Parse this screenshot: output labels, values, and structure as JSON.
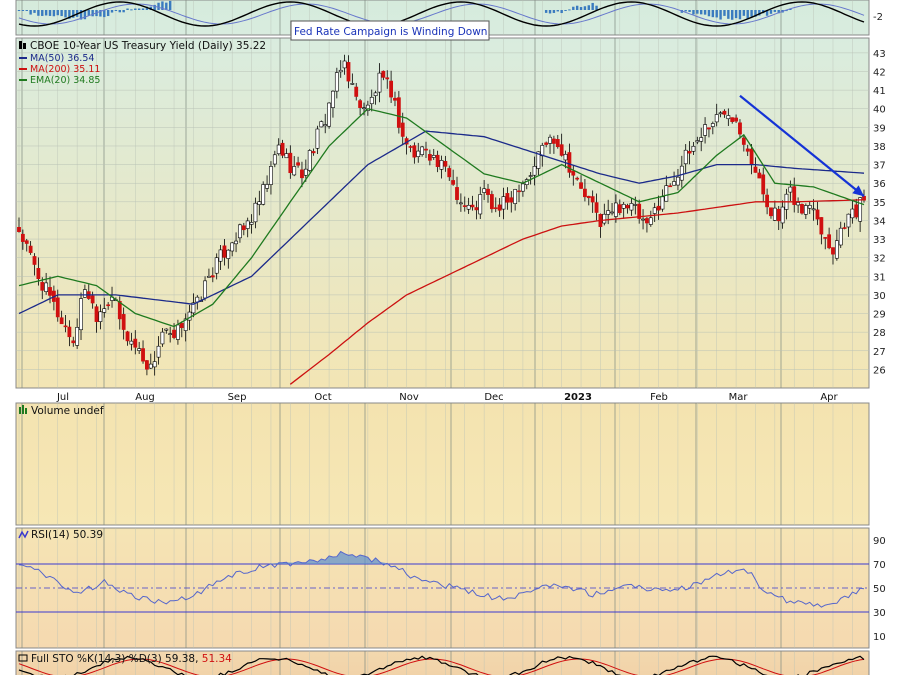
{
  "colors": {
    "up_candle": "#ffffff",
    "down_candle": "#d01010",
    "candle_outline": "#000000",
    "ma50": "#1b2a8a",
    "ma200": "#cc1111",
    "ema20": "#1f7a1f",
    "annotation_arrow": "#1533d6",
    "rsi_line": "#5566cc",
    "rsi_band": "#3a3ad0",
    "sto_k": "#000000",
    "sto_d": "#d01010",
    "macd_hist": "#3a7bbf"
  },
  "annotation": {
    "text": "Fed Rate Campaign is Winding Down"
  },
  "macd_panel": {
    "tick": "-2"
  },
  "price_panel": {
    "legend_title": "CBOE 10-Year US Treasury Yield (Daily) 35.22",
    "legend_ma50": "MA(50) 36.54",
    "legend_ma200": "MA(200) 35.11",
    "legend_ema20": "EMA(20) 34.85",
    "yticks": [
      "43",
      "42",
      "41",
      "40",
      "39",
      "38",
      "37",
      "36",
      "35",
      "34",
      "33",
      "32",
      "31",
      "30",
      "29",
      "28",
      "27",
      "26"
    ],
    "xticks": [
      "Jul",
      "Aug",
      "Sep",
      "Oct",
      "Nov",
      "Dec",
      "2023",
      "Feb",
      "Mar",
      "Apr"
    ]
  },
  "volume_panel": {
    "label": "Volume undef"
  },
  "rsi_panel": {
    "label": "RSI(14) 50.39",
    "yticks": [
      "90",
      "70",
      "50",
      "30",
      "10"
    ]
  },
  "sto_panel": {
    "label_main": "Full STO %K(14,3) %D(3) 59.38,",
    "label_d": "51.34"
  },
  "chart_data": {
    "type": "candlestick",
    "title": "CBOE 10-Year US Treasury Yield (Daily)",
    "ylim": [
      25,
      43.8
    ],
    "x_months": [
      "Jul",
      "Aug",
      "Sep",
      "Oct",
      "Nov",
      "Dec",
      "2023",
      "Feb",
      "Mar",
      "Apr"
    ],
    "close_anchors": [
      [
        0,
        33.5
      ],
      [
        5,
        31.0
      ],
      [
        10,
        29.0
      ],
      [
        14,
        27.5
      ],
      [
        17,
        30.5
      ],
      [
        20,
        29.0
      ],
      [
        24,
        30.0
      ],
      [
        27,
        28.0
      ],
      [
        31,
        27.0
      ],
      [
        34,
        26.0
      ],
      [
        37,
        28.0
      ],
      [
        40,
        27.5
      ],
      [
        43,
        29.0
      ],
      [
        46,
        29.5
      ],
      [
        49,
        31.0
      ],
      [
        52,
        32.0
      ],
      [
        55,
        33.0
      ],
      [
        58,
        33.5
      ],
      [
        61,
        34.5
      ],
      [
        64,
        36.0
      ],
      [
        67,
        38.0
      ],
      [
        70,
        37.0
      ],
      [
        73,
        36.5
      ],
      [
        76,
        38.0
      ],
      [
        79,
        39.5
      ],
      [
        81,
        41.0
      ],
      [
        84,
        42.5
      ],
      [
        87,
        40.5
      ],
      [
        90,
        40.0
      ],
      [
        93,
        41.5
      ],
      [
        96,
        41.0
      ],
      [
        99,
        38.5
      ],
      [
        102,
        37.5
      ],
      [
        105,
        38.0
      ],
      [
        108,
        37.0
      ],
      [
        111,
        36.5
      ],
      [
        114,
        35.0
      ],
      [
        117,
        34.5
      ],
      [
        120,
        35.5
      ],
      [
        123,
        34.5
      ],
      [
        126,
        35.0
      ],
      [
        129,
        36.0
      ],
      [
        132,
        36.5
      ],
      [
        135,
        38.0
      ],
      [
        138,
        38.5
      ],
      [
        141,
        37.5
      ],
      [
        144,
        36.0
      ],
      [
        147,
        35.0
      ],
      [
        150,
        34.0
      ],
      [
        153,
        34.5
      ],
      [
        156,
        35.0
      ],
      [
        159,
        34.5
      ],
      [
        162,
        33.5
      ],
      [
        165,
        35.0
      ],
      [
        168,
        36.0
      ],
      [
        171,
        37.0
      ],
      [
        174,
        38.0
      ],
      [
        177,
        39.0
      ],
      [
        180,
        39.5
      ],
      [
        183,
        40.0
      ],
      [
        185,
        39.5
      ],
      [
        188,
        38.0
      ],
      [
        190,
        36.5
      ],
      [
        193,
        35.0
      ],
      [
        196,
        34.0
      ],
      [
        199,
        35.5
      ],
      [
        202,
        34.5
      ],
      [
        205,
        35.0
      ],
      [
        208,
        33.0
      ],
      [
        210,
        32.5
      ],
      [
        213,
        34.0
      ],
      [
        216,
        34.5
      ],
      [
        218,
        35.22
      ]
    ],
    "ma50_points": [
      [
        0,
        29.0
      ],
      [
        10,
        30.0
      ],
      [
        25,
        30.0
      ],
      [
        45,
        29.5
      ],
      [
        60,
        31.0
      ],
      [
        75,
        34.0
      ],
      [
        90,
        37.0
      ],
      [
        105,
        38.8
      ],
      [
        120,
        38.5
      ],
      [
        135,
        37.5
      ],
      [
        150,
        36.5
      ],
      [
        160,
        36.0
      ],
      [
        170,
        36.4
      ],
      [
        180,
        37.0
      ],
      [
        190,
        37.0
      ],
      [
        200,
        36.8
      ],
      [
        218,
        36.54
      ]
    ],
    "ema20_points": [
      [
        0,
        30.5
      ],
      [
        10,
        31.0
      ],
      [
        20,
        30.5
      ],
      [
        30,
        29.0
      ],
      [
        40,
        28.3
      ],
      [
        50,
        29.5
      ],
      [
        60,
        32.0
      ],
      [
        70,
        35.0
      ],
      [
        80,
        38.0
      ],
      [
        90,
        40.0
      ],
      [
        100,
        39.5
      ],
      [
        110,
        38.0
      ],
      [
        120,
        36.5
      ],
      [
        130,
        36.0
      ],
      [
        140,
        37.0
      ],
      [
        150,
        36.0
      ],
      [
        160,
        35.0
      ],
      [
        170,
        35.5
      ],
      [
        180,
        37.5
      ],
      [
        187,
        38.6
      ],
      [
        195,
        36.0
      ],
      [
        205,
        35.8
      ],
      [
        218,
        34.85
      ]
    ],
    "ma200_points": [
      [
        70,
        25.2
      ],
      [
        80,
        26.8
      ],
      [
        90,
        28.5
      ],
      [
        100,
        30.0
      ],
      [
        110,
        31.0
      ],
      [
        120,
        32.0
      ],
      [
        130,
        33.0
      ],
      [
        140,
        33.7
      ],
      [
        150,
        34.0
      ],
      [
        160,
        34.2
      ],
      [
        170,
        34.4
      ],
      [
        180,
        34.7
      ],
      [
        190,
        35.0
      ],
      [
        200,
        35.0
      ],
      [
        218,
        35.11
      ]
    ],
    "arrow_points": [
      [
        186,
        40.7
      ],
      [
        218,
        35.3
      ]
    ],
    "rsi": {
      "ylim": [
        0,
        100
      ],
      "bands": [
        30,
        70
      ],
      "midline": 50,
      "anchors": [
        [
          0,
          70
        ],
        [
          8,
          60
        ],
        [
          15,
          45
        ],
        [
          22,
          55
        ],
        [
          30,
          42
        ],
        [
          38,
          38
        ],
        [
          46,
          45
        ],
        [
          54,
          60
        ],
        [
          62,
          67
        ],
        [
          70,
          70
        ],
        [
          78,
          74
        ],
        [
          84,
          80
        ],
        [
          90,
          75
        ],
        [
          97,
          68
        ],
        [
          104,
          55
        ],
        [
          110,
          52
        ],
        [
          118,
          45
        ],
        [
          126,
          40
        ],
        [
          134,
          50
        ],
        [
          140,
          52
        ],
        [
          148,
          45
        ],
        [
          156,
          52
        ],
        [
          164,
          48
        ],
        [
          172,
          50
        ],
        [
          180,
          60
        ],
        [
          187,
          68
        ],
        [
          193,
          45
        ],
        [
          200,
          38
        ],
        [
          208,
          35
        ],
        [
          214,
          42
        ],
        [
          218,
          50.39
        ]
      ]
    },
    "stochastic": {
      "k": 59.38,
      "d": 51.34
    }
  }
}
